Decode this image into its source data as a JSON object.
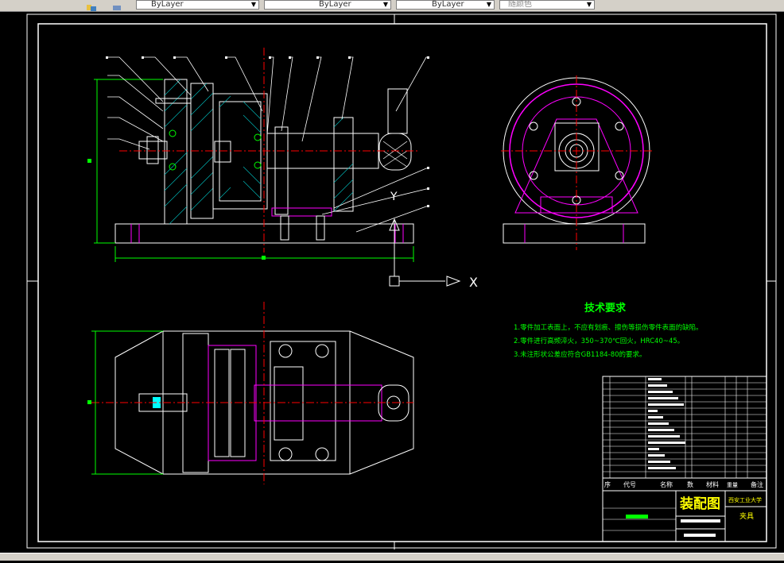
{
  "toolbar": {
    "layer_color": "ByLayer",
    "linetype": "ByLayer",
    "lineweight": "ByLayer",
    "plot_style": "随颜色"
  },
  "drawing": {
    "axis_x_label": "X",
    "axis_y_label": "Y",
    "tech_title": "技术要求",
    "tech_notes": [
      "1.零件加工表面上，不应有划痕、擦伤等损伤零件表面的缺陷。",
      "2.零件进行高频淬火，350~370℃回火，HRC40~45。",
      "3.未注形状公差应符合GB1184-80的要求。"
    ],
    "title_block": {
      "drawing_name": "装配图",
      "school": "西安工业大学",
      "part_name": "夹具",
      "col_seq": "序",
      "col_code": "代号",
      "col_name": "名称",
      "col_qty": "数",
      "col_material": "材料",
      "col_weight": "重量",
      "col_remark": "备注"
    }
  },
  "colors": {
    "green": "#00ff00",
    "cyan": "#00ffff",
    "red": "#ff0000",
    "magenta": "#ff00ff",
    "white": "#ffffff",
    "yellow": "#ffff00",
    "hatch": "#00b4b4"
  }
}
